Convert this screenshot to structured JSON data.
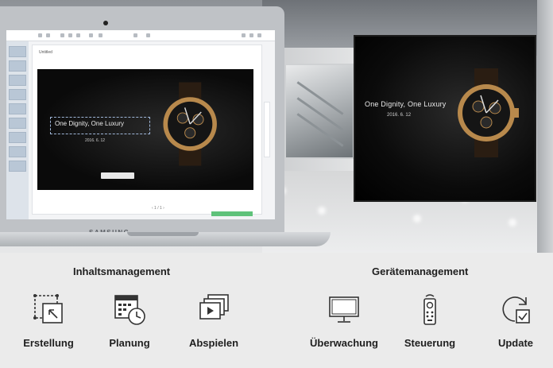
{
  "hero": {
    "big_screen_text": "One Dignity, One Luxury",
    "big_screen_date": "2016. 6. 12",
    "editor_text": "One Dignity, One Luxury",
    "editor_date": "2016. 6. 12",
    "editor_tab": "Untitled"
  },
  "laptop": {
    "brand": "SAMSUNG"
  },
  "panel": {
    "left_heading": "Inhaltsmanagement",
    "right_heading": "Gerätemanagement",
    "features": [
      {
        "label": "Erstellung",
        "icon": "create-icon"
      },
      {
        "label": "Planung",
        "icon": "calendar-clock-icon"
      },
      {
        "label": "Abspielen",
        "icon": "playlist-play-icon"
      },
      {
        "label": "Überwachung",
        "icon": "monitor-icon"
      },
      {
        "label": "Steuerung",
        "icon": "remote-control-icon"
      },
      {
        "label": "Update",
        "icon": "update-icon"
      }
    ]
  }
}
